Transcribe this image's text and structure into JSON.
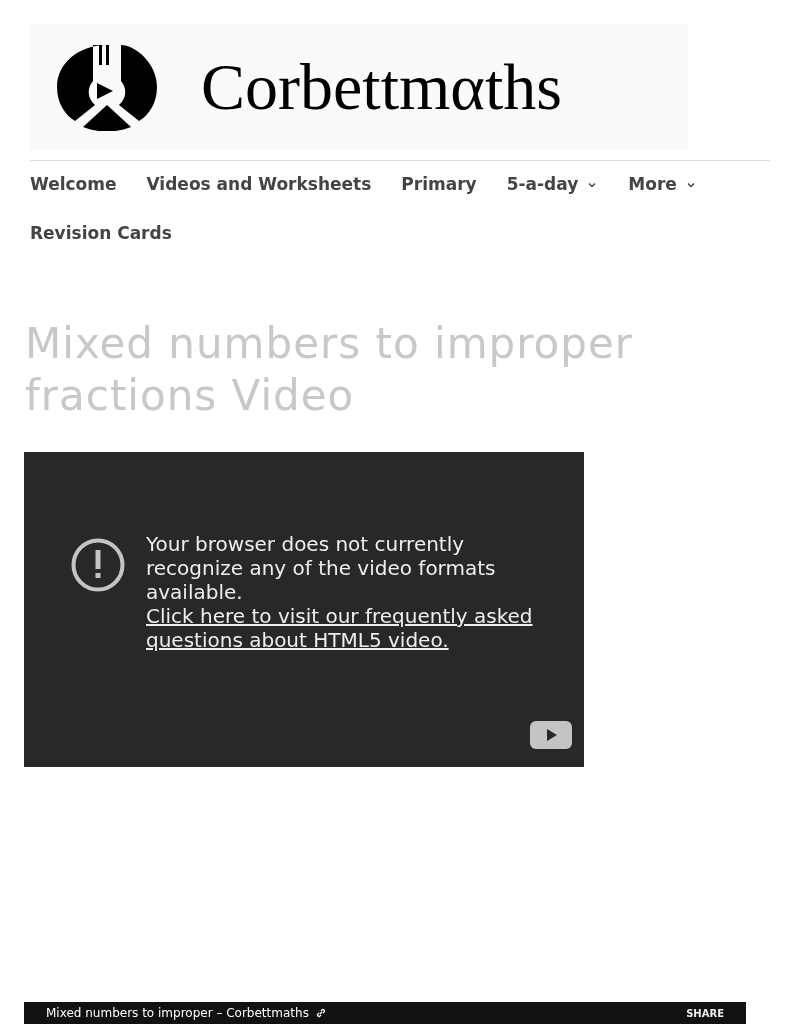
{
  "header": {
    "logo_text": "Corbettmαths"
  },
  "nav": [
    {
      "label": "Welcome",
      "has_dropdown": false
    },
    {
      "label": "Videos and Worksheets",
      "has_dropdown": false
    },
    {
      "label": "Primary",
      "has_dropdown": false
    },
    {
      "label": "5-a-day",
      "has_dropdown": true
    },
    {
      "label": "More",
      "has_dropdown": true
    },
    {
      "label": "Revision Cards",
      "has_dropdown": false
    }
  ],
  "page_title": "Mixed numbers to improper fractions Video",
  "video_player": {
    "message": "Your browser does not currently recognize any of the video formats available.",
    "link": "Click here to visit our frequently asked questions about HTML5 video."
  },
  "embed": {
    "title": "Mixed numbers to improper – Corbettmaths",
    "share": "SHARE"
  }
}
